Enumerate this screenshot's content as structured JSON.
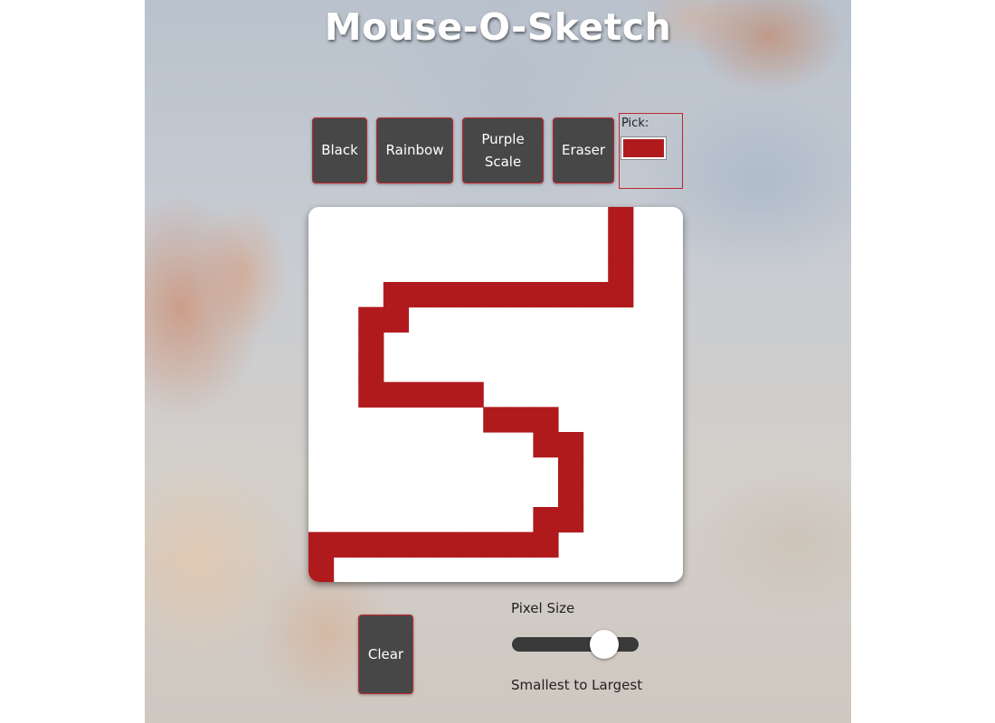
{
  "app": {
    "title": "Mouse-O-Sketch"
  },
  "toolbar": {
    "black_label": "Black",
    "rainbow_label": "Rainbow",
    "purple_label": "Purple\nScale",
    "eraser_label": "Eraser",
    "picker_label": "Pick:",
    "picker_color": "#b01a1d"
  },
  "canvas": {
    "grid_size": 15,
    "background_color": "#ffffff",
    "ink_color": "#b01a1d",
    "painted_cells": [
      [
        12,
        0
      ],
      [
        12,
        1
      ],
      [
        12,
        2
      ],
      [
        3,
        3
      ],
      [
        4,
        3
      ],
      [
        5,
        3
      ],
      [
        6,
        3
      ],
      [
        7,
        3
      ],
      [
        8,
        3
      ],
      [
        9,
        3
      ],
      [
        10,
        3
      ],
      [
        11,
        3
      ],
      [
        12,
        3
      ],
      [
        2,
        4
      ],
      [
        3,
        4
      ],
      [
        2,
        5
      ],
      [
        2,
        6
      ],
      [
        2,
        7
      ],
      [
        3,
        7
      ],
      [
        4,
        7
      ],
      [
        5,
        7
      ],
      [
        6,
        7
      ],
      [
        7,
        8
      ],
      [
        8,
        8
      ],
      [
        9,
        8
      ],
      [
        9,
        9
      ],
      [
        10,
        9
      ],
      [
        10,
        10
      ],
      [
        10,
        11
      ],
      [
        9,
        12
      ],
      [
        10,
        12
      ],
      [
        0,
        13
      ],
      [
        1,
        13
      ],
      [
        2,
        13
      ],
      [
        3,
        13
      ],
      [
        4,
        13
      ],
      [
        5,
        13
      ],
      [
        6,
        13
      ],
      [
        7,
        13
      ],
      [
        8,
        13
      ],
      [
        9,
        13
      ],
      [
        0,
        14
      ]
    ]
  },
  "controls": {
    "clear_label": "Clear",
    "slider_title": "Pixel Size",
    "slider_caption": "Smallest to Largest",
    "slider_value_fraction": 0.8
  }
}
